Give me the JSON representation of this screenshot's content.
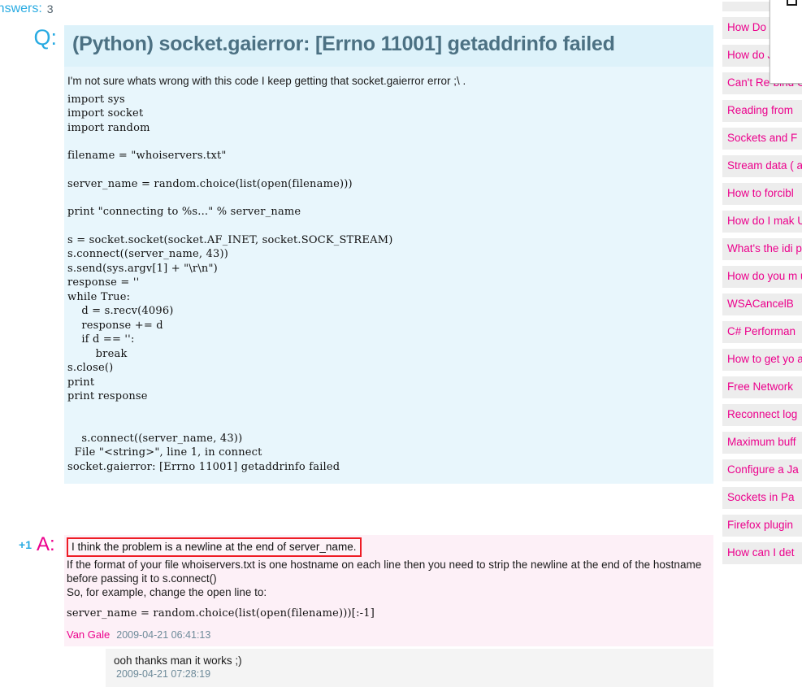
{
  "top": {
    "answers_label": "Answers:",
    "answers_count": "3"
  },
  "question": {
    "marker": "Q:",
    "title": "(Python) socket.gaierror: [Errno 11001] getaddrinfo failed",
    "intro": "I'm not sure whats wrong with this code I keep getting that socket.gaierror error ;\\ .",
    "code_block_1": "import sys\nimport socket\nimport random",
    "code_block_2": "filename = \"whoiservers.txt\"",
    "code_block_3": "server_name = random.choice(list(open(filename)))",
    "code_block_4": "print \"connecting to %s...\" % server_name",
    "code_block_5": "s = socket.socket(socket.AF_INET, socket.SOCK_STREAM)\ns.connect((server_name, 43))\ns.send(sys.argv[1] + \"\\r\\n\")\nresponse = ''\nwhile True:\n    d = s.recv(4096)\n    response += d\n    if d == '':\n        break\ns.close()\nprint\nprint response",
    "traceback": "    s.connect((server_name, 43))\n  File \"<string>\", line 1, in connect\nsocket.gaierror: [Errno 11001] getaddrinfo failed"
  },
  "answer": {
    "vote": "+1",
    "marker": "A:",
    "highlighted_line": "I think the problem is a newline at the end of server_name.",
    "paragraph_1": "If the format of your file whoiservers.txt is one hostname on each line then you need to strip the newline at the end of the hostname before passing it to s.connect()",
    "paragraph_2": "So, for example, change the open line to:",
    "code": "server_name = random.choice(list(open(filename)))[:-1]",
    "author": "Van Gale",
    "timestamp": "2009-04-21 06:41:13"
  },
  "comment": {
    "text": "ooh thanks man it works ;)",
    "timestamp": "2009-04-21 07:28:19"
  },
  "sidebar": {
    "items": [
      {
        "label": "How Do"
      },
      {
        "label": "How do Java on"
      },
      {
        "label": "Can't Re-bind Combination"
      },
      {
        "label": "Reading from"
      },
      {
        "label": "Sockets and F"
      },
      {
        "label": "Stream data ( another langu"
      },
      {
        "label": "How to forcibl"
      },
      {
        "label": "How do I mak Unix in Ruby?"
      },
      {
        "label": "What's the idi programming"
      },
      {
        "label": "How do you m used in a tcp s"
      },
      {
        "label": "WSACancelB"
      },
      {
        "label": "C# Performan"
      },
      {
        "label": "How to get yo an udp-socke"
      },
      {
        "label": "Free Network"
      },
      {
        "label": "Reconnect log"
      },
      {
        "label": "Maximum buff"
      },
      {
        "label": "Configure a Ja disconnect?"
      },
      {
        "label": "Sockets in Pa"
      },
      {
        "label": "Firefox plugin"
      },
      {
        "label": "How can I det"
      }
    ]
  },
  "colors": {
    "accent_blue": "#29abe2",
    "accent_magenta": "#ec008c",
    "question_bg": "#e8f6fc",
    "question_title_bg": "#ddf2fa",
    "answer_bg": "#fdf0f7",
    "highlight_border": "#ee1c25",
    "sidebar_item_bg": "#ededed"
  }
}
